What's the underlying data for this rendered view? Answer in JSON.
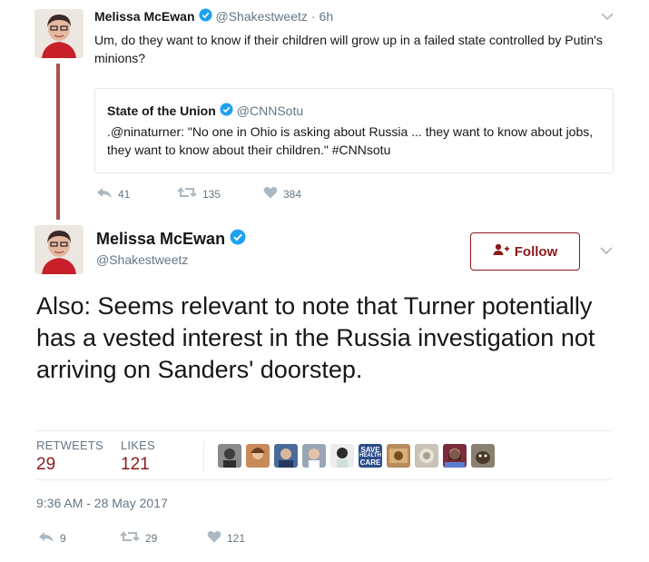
{
  "reply_tweet": {
    "author_name": "Melissa McEwan",
    "handle": "@Shakestweetz",
    "separator": "·",
    "time": "6h",
    "text": "Um, do they want to know if their children will grow up in a failed state controlled by Putin's minions?",
    "quote": {
      "author_name": "State of the Union",
      "handle": "@CNNSotu",
      "text": ".@ninaturner: \"No one in Ohio is asking about Russia ... they want to know about jobs, they want to know about their children.\" #CNNsotu"
    },
    "actions": {
      "replies": "41",
      "retweets": "135",
      "likes": "384"
    }
  },
  "main_tweet": {
    "author_name": "Melissa McEwan",
    "handle": "@Shakestweetz",
    "follow_label": "Follow",
    "text": "Also: Seems relevant to note that Turner potentially has a vested interest in the Russia investigation not arriving on Sanders' doorstep.",
    "stats": {
      "retweets_label": "RETWEETS",
      "retweets_value": "29",
      "likes_label": "LIKES",
      "likes_value": "121"
    },
    "likers_badge_text": [
      "SAVE",
      "HEALTH",
      "CARE"
    ],
    "timestamp": "9:36 AM - 28 May 2017",
    "actions": {
      "replies": "9",
      "retweets": "29",
      "likes": "121"
    }
  },
  "colors": {
    "accent": "#8b1a1a",
    "verified": "#1da1f2",
    "muted": "#657786",
    "divider": "#e6ecf0"
  },
  "icons": [
    "verified-badge-icon",
    "chevron-down-icon",
    "reply-icon",
    "retweet-icon",
    "heart-icon",
    "follow-person-icon"
  ]
}
